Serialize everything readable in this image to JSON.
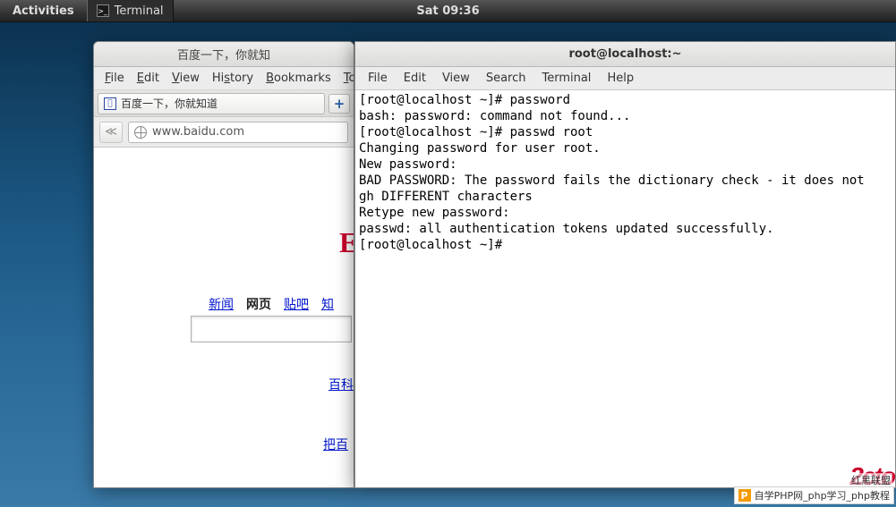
{
  "panel": {
    "activities": "Activities",
    "task_label": "Terminal",
    "clock": "Sat 09:36"
  },
  "browser": {
    "title": "百度一下，你就知",
    "menu": {
      "file": "File",
      "edit": "Edit",
      "view": "View",
      "history": "History",
      "bookmarks": "Bookmarks",
      "tools": "To"
    },
    "tab_label": "百度一下，你就知道",
    "addtab": "+",
    "navback": "≪",
    "url": "www.baidu.com",
    "logo_fragment": "E",
    "nav": {
      "news": "新闻",
      "web": "网页",
      "tieba": "贴吧",
      "zhi": "知"
    },
    "baike": "百科",
    "more": "把百"
  },
  "terminal": {
    "title": "root@localhost:~",
    "menu": {
      "file": "File",
      "edit": "Edit",
      "view": "View",
      "search": "Search",
      "terminal": "Terminal",
      "help": "Help"
    },
    "lines": [
      "[root@localhost ~]# password",
      "bash: password: command not found...",
      "[root@localhost ~]# passwd root",
      "Changing password for user root.",
      "New password:",
      "BAD PASSWORD: The password fails the dictionary check - it does not",
      "gh DIFFERENT characters",
      "Retype new password:",
      "passwd: all authentication tokens updated successfully.",
      "[root@localhost ~]# "
    ]
  },
  "watermark": {
    "logo": "2cto",
    "sub": "红黑联盟",
    "footer": "自学PHP网_php学习_php教程"
  }
}
